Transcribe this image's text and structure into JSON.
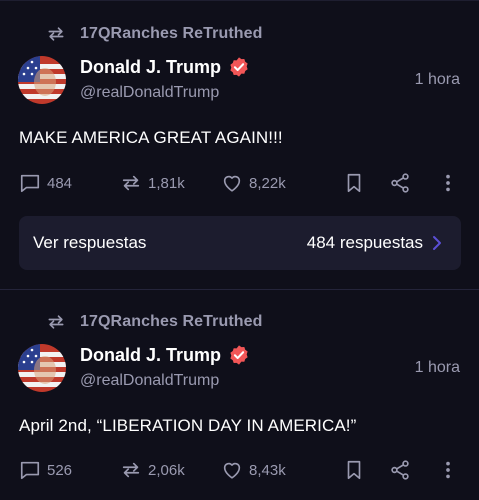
{
  "colors": {
    "background": "#0f0f1a",
    "muted_text": "#9a9ab0",
    "verified_badge": "#f25657",
    "replies_panel": "#1c1c2e",
    "accent_chevron": "#5b4fd6"
  },
  "posts": [
    {
      "retruth_label": "17QRanches ReTruthed",
      "author_name": "Donald J. Trump",
      "author_handle": "@realDonaldTrump",
      "timestamp": "1 hora",
      "text": "MAKE AMERICA GREAT AGAIN!!!",
      "replies": "484",
      "retruths": "1,81k",
      "likes": "8,22k",
      "replies_panel": {
        "label": "Ver respuestas",
        "count_label": "484 respuestas"
      }
    },
    {
      "retruth_label": "17QRanches ReTruthed",
      "author_name": "Donald J. Trump",
      "author_handle": "@realDonaldTrump",
      "timestamp": "1 hora",
      "text": "April 2nd, “LIBERATION DAY IN AMERICA!”",
      "replies": "526",
      "retruths": "2,06k",
      "likes": "8,43k"
    }
  ],
  "icons": {
    "retruth": "retruth-icon",
    "verified": "verified-badge-icon",
    "reply": "speech-bubble-icon",
    "retruth_action": "retruth-arrows-icon",
    "like": "heart-icon",
    "bookmark": "bookmark-icon",
    "share": "share-icon",
    "more": "vertical-dots-icon",
    "chevron": "chevron-right-icon"
  }
}
